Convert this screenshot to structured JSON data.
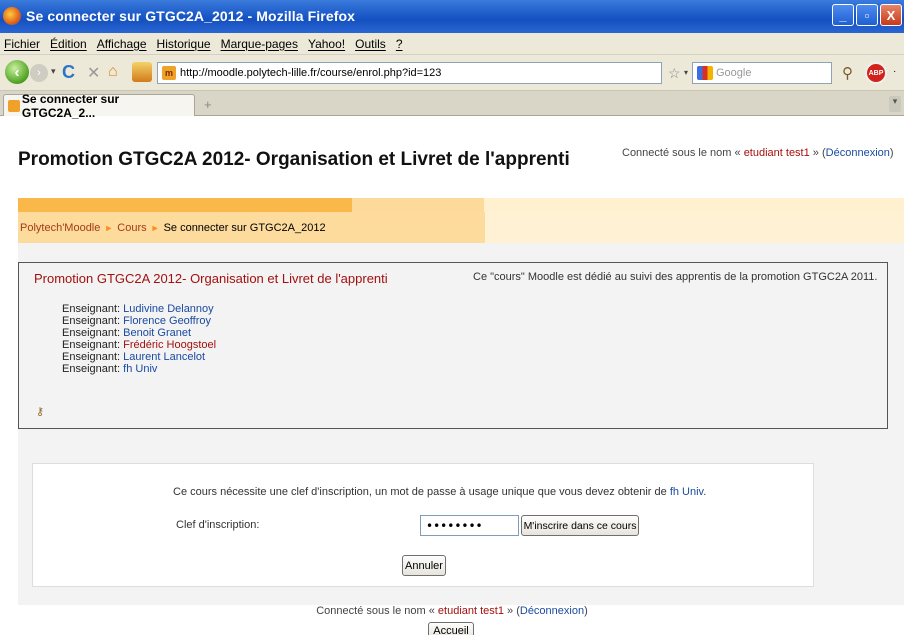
{
  "window": {
    "title": "Se connecter sur GTGC2A_2012 - Mozilla Firefox",
    "controls": [
      "_",
      "▫",
      "X"
    ]
  },
  "menu": [
    "Fichier",
    "Édition",
    "Affichage",
    "Historique",
    "Marque-pages",
    "Yahoo!",
    "Outils",
    "?"
  ],
  "toolbar": {
    "url": "http://moodle.polytech-lille.fr/course/enrol.php?id=123",
    "search_placeholder": "Google",
    "abp_label": "ABP"
  },
  "tab": {
    "label": "Se connecter sur GTGC2A_2...",
    "new_tab": "+"
  },
  "page": {
    "title": "Promotion GTGC2A 2012- Organisation et Livret de l'apprenti",
    "login": {
      "prefix": "Connecté sous le nom « ",
      "user": "etudiant test1",
      "mid": " » (",
      "logout": "Déconnexion",
      "suffix": ")"
    },
    "breadcrumb": [
      "Polytech'Moodle",
      "Cours",
      "Se connecter sur GTGC2A_2012"
    ]
  },
  "course": {
    "name": "Promotion GTGC2A 2012- Organisation et Livret de l'apprenti",
    "summary": "Ce \"cours\" Moodle est dédié au suivi des apprentis de la promotion GTGC2A 2011.",
    "teacher_label": "Enseignant: ",
    "teachers": [
      "Ludivine Delannoy",
      "Florence Geoffroy",
      "Benoit Granet",
      "Frédéric Hoogstoel",
      "Laurent Lancelot",
      "fh Univ"
    ]
  },
  "enrol": {
    "message_prefix": "Ce cours nécessite une clef d'inscription, un mot de passe à usage unique que vous devez obtenir de ",
    "message_teacher": "fh Univ",
    "message_suffix": ".",
    "label": "Clef d'inscription:",
    "password_value": "••••••••",
    "submit": "M'inscrire dans ce cours",
    "cancel": "Annuler"
  },
  "footer": {
    "prefix": "Connecté sous le nom « ",
    "user": "etudiant test1",
    "mid": " » (",
    "logout": "Déconnexion",
    "suffix": ")",
    "home": "Accueil"
  }
}
